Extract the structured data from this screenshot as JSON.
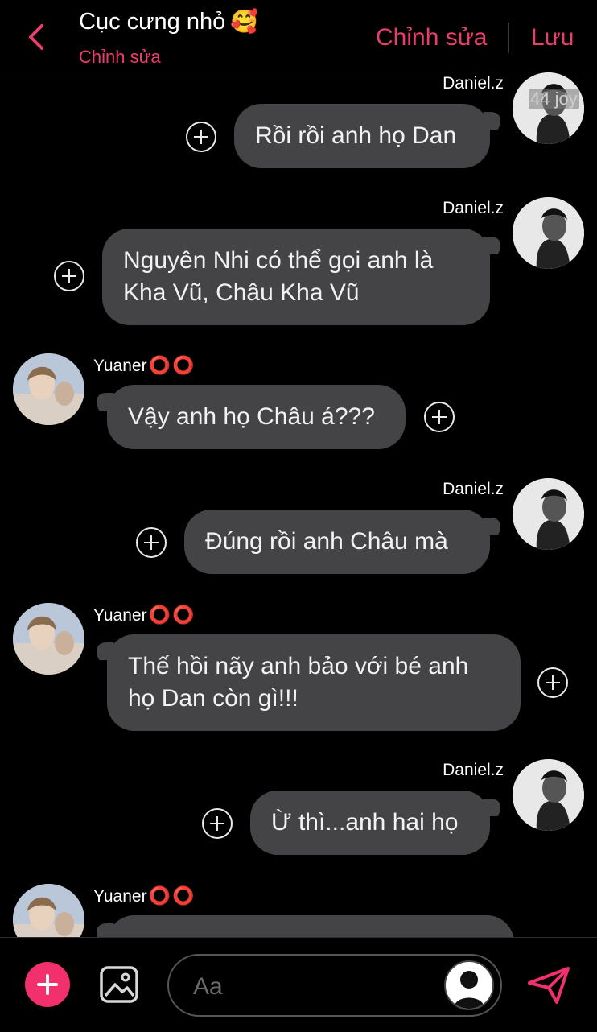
{
  "header": {
    "title": "Cục cưng nhỏ",
    "title_emoji": "🥰",
    "subtitle": "Chỉnh sửa",
    "edit_label": "Chỉnh sửa",
    "save_label": "Lưu",
    "accent_color": "#ea3d6b"
  },
  "messages": [
    {
      "sender": "Daniel.z",
      "side": "right",
      "text": "Rồi rồi anh họ Dan",
      "avatar_watermark": "44 joy"
    },
    {
      "sender": "Daniel.z",
      "side": "right",
      "text": "Nguyên Nhi có thể gọi anh là Kha Vũ, Châu Kha Vũ"
    },
    {
      "sender": "Yuaner",
      "sender_suffix": "⭕⭕",
      "side": "left",
      "text": "Vậy anh họ Châu á???"
    },
    {
      "sender": "Daniel.z",
      "side": "right",
      "text": "Đúng rồi anh Châu mà"
    },
    {
      "sender": "Yuaner",
      "sender_suffix": "⭕⭕",
      "side": "left",
      "text": "Thế hồi nãy anh bảo với bé anh họ Dan còn gì!!!"
    },
    {
      "sender": "Daniel.z",
      "side": "right",
      "text": "Ừ thì...anh hai họ"
    },
    {
      "sender": "Yuaner",
      "sender_suffix": "⭕⭕",
      "side": "left",
      "text": ""
    }
  ],
  "composer": {
    "placeholder": "Aa",
    "add_icon": "plus-icon",
    "image_icon": "image-icon",
    "send_icon": "send-icon",
    "button_color": "#f2306e"
  }
}
